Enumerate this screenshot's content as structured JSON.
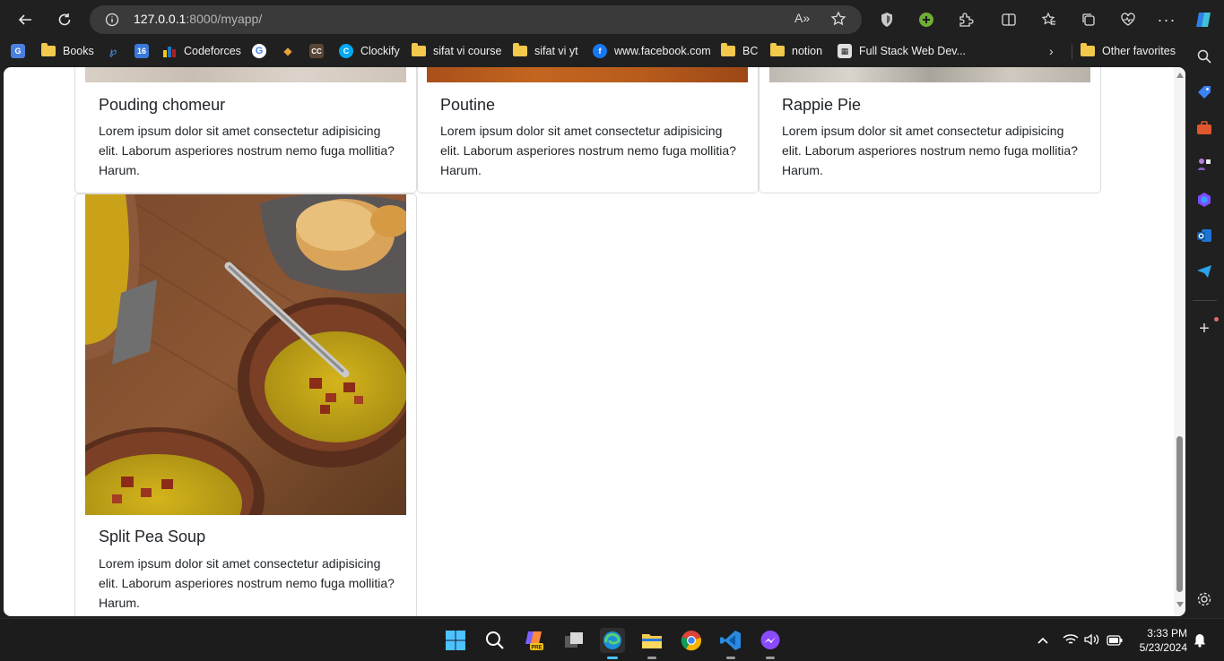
{
  "browser": {
    "url_host": "127.0.0.1",
    "url_rest": ":8000/myapp/",
    "read_aloud_label": "A»"
  },
  "bookmarks": [
    {
      "label": "Books",
      "icon": "folder-icon"
    },
    {
      "label": "Codeforces",
      "icon": "codeforces-icon"
    },
    {
      "label": "Clockify",
      "icon": "clockify-icon"
    },
    {
      "label": "sifat vi course",
      "icon": "folder-icon"
    },
    {
      "label": "sifat vi yt",
      "icon": "folder-icon"
    },
    {
      "label": "www.facebook.com",
      "icon": "facebook-icon"
    },
    {
      "label": "BC",
      "icon": "folder-icon"
    },
    {
      "label": "notion",
      "icon": "folder-icon"
    },
    {
      "label": "Full Stack Web Dev...",
      "icon": "grid-icon"
    },
    {
      "label": "Other favorites",
      "icon": "folder-icon"
    }
  ],
  "cards": [
    {
      "title": "Pouding chomeur",
      "text": "Lorem ipsum dolor sit amet consectetur adipisicing elit. Laborum asperiores nostrum nemo fuga mollitia? Harum."
    },
    {
      "title": "Poutine",
      "text": "Lorem ipsum dolor sit amet consectetur adipisicing elit. Laborum asperiores nostrum nemo fuga mollitia? Harum."
    },
    {
      "title": "Rappie Pie",
      "text": "Lorem ipsum dolor sit amet consectetur adipisicing elit. Laborum asperiores nostrum nemo fuga mollitia? Harum."
    },
    {
      "title": "Split Pea Soup",
      "text": "Lorem ipsum dolor sit amet consectetur adipisicing elit. Laborum asperiores nostrum nemo fuga mollitia? Harum."
    }
  ],
  "taskbar": {
    "time": "3:33 PM",
    "date": "5/23/2024"
  },
  "colors": {
    "browser_bg": "#202020",
    "address_bg": "#3a3a3a",
    "page_bg": "#ffffff",
    "text": "#212529"
  }
}
